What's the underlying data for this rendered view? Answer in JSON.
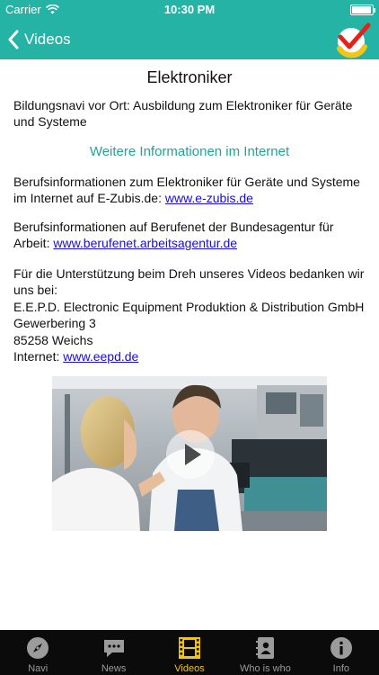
{
  "status": {
    "carrier": "Carrier",
    "time": "10:30 PM",
    "battery_level": 0.95
  },
  "nav": {
    "back_label": "Videos",
    "color": "#24b3a4"
  },
  "article": {
    "title": "Elektroniker",
    "intro": "Bildungsnavi vor Ort: Ausbildung zum Elektroniker für Geräte und Systeme",
    "more_info_link": "Weitere Informationen im Internet",
    "zubis_text": "Berufsinformationen zum Elektroniker für Geräte und Systeme im Internet auf E-Zubis.de: ",
    "zubis_link": "www.e-zubis.de",
    "berufenet_text": "Berufsinformationen auf Berufenet der Bundesagentur für Arbeit: ",
    "berufenet_link": "www.berufenet.arbeitsagentur.de",
    "thanks_text": "Für die Unterstützung beim Dreh unseres Videos bedanken wir uns bei:",
    "company": "E.E.P.D. Electronic Equipment Produktion & Distribution GmbH",
    "street": "Gewerbering 3",
    "city": "85258 Weichs",
    "internet_label": "Internet: ",
    "internet_link": "www.eepd.de"
  },
  "tabs": [
    {
      "label": "Navi",
      "icon": "compass-icon",
      "active": false
    },
    {
      "label": "News",
      "icon": "speech-bubble-icon",
      "active": false
    },
    {
      "label": "Videos",
      "icon": "film-strip-icon",
      "active": true
    },
    {
      "label": "Who is who",
      "icon": "contacts-book-icon",
      "active": false
    },
    {
      "label": "Info",
      "icon": "info-icon",
      "active": false
    }
  ],
  "colors": {
    "accent": "#24b3a4",
    "link": "#1a0dd6",
    "tab_active": "#f0c419"
  }
}
